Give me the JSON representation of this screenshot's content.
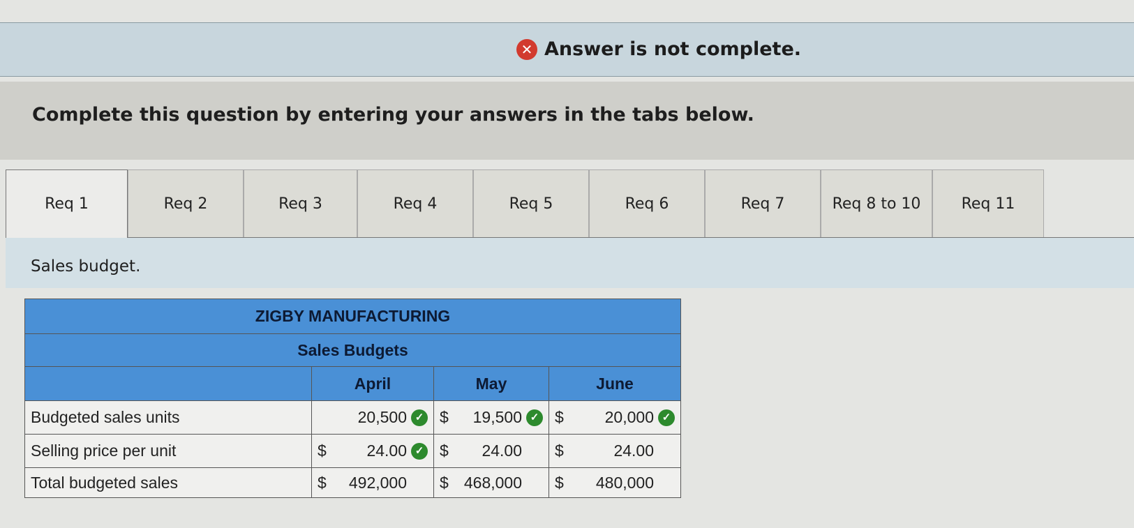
{
  "banner": {
    "message": "Answer is not complete.",
    "icon": "x-circle-icon",
    "color": "#d23a2e"
  },
  "instructions": "Complete this question by entering your answers in the tabs below.",
  "tabs": [
    {
      "label": "Req 1",
      "active": true
    },
    {
      "label": "Req 2"
    },
    {
      "label": "Req 3"
    },
    {
      "label": "Req 4"
    },
    {
      "label": "Req 5"
    },
    {
      "label": "Req 6"
    },
    {
      "label": "Req 7"
    },
    {
      "label": "Req 8 to 10"
    },
    {
      "label": "Req 11"
    }
  ],
  "section_title": "Sales budget.",
  "table": {
    "company": "ZIGBY MANUFACTURING",
    "title": "Sales Budgets",
    "columns": [
      "April",
      "May",
      "June"
    ],
    "rows": [
      {
        "label": "Budgeted sales units",
        "cells": [
          {
            "prefix": "",
            "value": "20,500",
            "correct": true
          },
          {
            "prefix": "$",
            "value": "19,500",
            "correct": true
          },
          {
            "prefix": "$",
            "value": "20,000",
            "correct": true
          }
        ]
      },
      {
        "label": "Selling price per unit",
        "cells": [
          {
            "prefix": "$",
            "value": "24.00",
            "correct": true
          },
          {
            "prefix": "$",
            "value": "24.00",
            "correct": false
          },
          {
            "prefix": "$",
            "value": "24.00",
            "correct": false
          }
        ]
      },
      {
        "label": "Total budgeted sales",
        "cells": [
          {
            "prefix": "$",
            "value": "492,000",
            "correct": false
          },
          {
            "prefix": "$",
            "value": "468,000",
            "correct": false
          },
          {
            "prefix": "$",
            "value": "480,000",
            "correct": false
          }
        ]
      }
    ]
  }
}
